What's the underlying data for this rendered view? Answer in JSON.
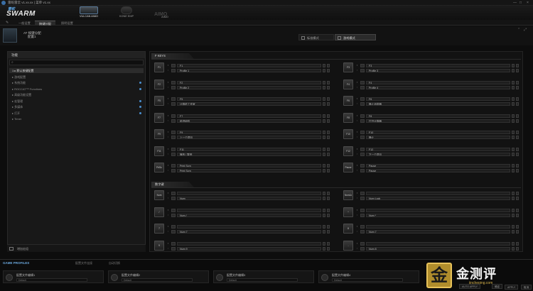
{
  "window": {
    "title": "雷蛇雷云 v1.xx.xx | 菜单 v1.xx",
    "controls": [
      "—",
      "□",
      "×"
    ]
  },
  "header": {
    "logo_small": "雷蛇",
    "logo_main": "SWARM",
    "devices": [
      {
        "label": "VULCAN AIMO",
        "active": true
      },
      {
        "label": "KONE EMP",
        "active": false
      },
      {
        "label": "AIMO",
        "active": false
      }
    ],
    "aimo_text": "AIMO"
  },
  "tabs": [
    {
      "label": "一般设置",
      "active": false
    },
    {
      "label": "按键分配",
      "active": true
    },
    {
      "label": "照明设置",
      "active": false
    }
  ],
  "profile": {
    "name": "AT 按键分配",
    "sub": "配置1",
    "modes": {
      "standard": "标准模式",
      "easy": "游戏模式"
    }
  },
  "left": {
    "header": "功能",
    "search_placeholder": "",
    "tree": [
      {
        "label": "1 ▸ 默认按键配置",
        "selected": true,
        "dot": false
      },
      {
        "label": "▸ 游戏配置",
        "selected": false,
        "dot": false
      },
      {
        "label": "▸ 系统功能",
        "selected": false,
        "dot": true
      },
      {
        "label": "▸ ROCCAT™ Functions",
        "selected": false,
        "dot": true
      },
      {
        "label": "▸ 高级功能设置",
        "selected": false,
        "dot": false
      },
      {
        "label": "▸ 宏管理",
        "selected": false,
        "dot": true
      },
      {
        "label": "▸ 多媒体",
        "selected": false,
        "dot": true
      },
      {
        "label": "▸ 打开",
        "selected": false,
        "dot": true
      },
      {
        "label": "▸ Timer",
        "selected": false,
        "dot": false
      }
    ],
    "bottom_label": "增加宏组"
  },
  "sections": {
    "fkeys": "F KEYS",
    "numpad": "数字键"
  },
  "fkeys_left": [
    {
      "key": "F1",
      "name": "F1",
      "easy": "Profile 1"
    },
    {
      "key": "F2",
      "name": "F2",
      "easy": "Profile 2"
    },
    {
      "key": "F5",
      "name": "F5",
      "easy": "计算机工作室"
    },
    {
      "key": "F7",
      "name": "F7",
      "easy": "前进组件"
    },
    {
      "key": "F9",
      "name": "F9",
      "easy": "上一个项目"
    },
    {
      "key": "F11",
      "name": "F11",
      "easy": "播放 / 暂停"
    },
    {
      "key": "PrtSc",
      "name": "Print Scrn",
      "easy": "Print Scrn"
    }
  ],
  "fkeys_right": [
    {
      "key": "F3",
      "name": "F3",
      "easy": "Profile 3"
    },
    {
      "key": "F4",
      "name": "F4",
      "easy": "Profile 4"
    },
    {
      "key": "F6",
      "name": "F6",
      "easy": "静止消息器"
    },
    {
      "key": "F8",
      "name": "F8",
      "easy": "打开计算器"
    },
    {
      "key": "F10",
      "name": "F10",
      "easy": "静止"
    },
    {
      "key": "F12",
      "name": "F12",
      "easy": "下一个项目"
    },
    {
      "key": "Pause",
      "name": "Pause",
      "easy": "Pause"
    }
  ],
  "numpad_left": [
    {
      "key": "Num",
      "name": "",
      "easy": "Num"
    },
    {
      "key": "/",
      "name": "",
      "easy": "Num /"
    },
    {
      "key": "7",
      "name": "",
      "easy": "Num 7"
    },
    {
      "key": "9",
      "name": "",
      "easy": "Num 9"
    }
  ],
  "numpad_right": [
    {
      "key": "NumLk",
      "name": "",
      "easy": "Num Lock"
    },
    {
      "key": "*",
      "name": "",
      "easy": "Num *"
    },
    {
      "key": "8",
      "name": "",
      "easy": "Num 7"
    },
    {
      "key": "-",
      "name": "",
      "easy": "Num 8"
    }
  ],
  "bottom": {
    "title": "GAME PROFILES",
    "tabs": [
      "配置文件连接",
      "自动切换"
    ],
    "slots": [
      {
        "name": "配置文件编辑1",
        "sub": "Default"
      },
      {
        "name": "配置文件编辑2",
        "sub": "Default"
      },
      {
        "name": "配置文件编辑3",
        "sub": "Default"
      },
      {
        "name": "配置文件编辑4",
        "sub": "Default"
      }
    ],
    "buttons": [
      "AUTO APPLY",
      "确定",
      "APPLY",
      "取消"
    ]
  },
  "watermark": {
    "seal": "金",
    "text": "金测评",
    "url": "jincheping.com"
  },
  "colors": {
    "accent": "#5fa8e8",
    "gold": "#d6b24a"
  }
}
